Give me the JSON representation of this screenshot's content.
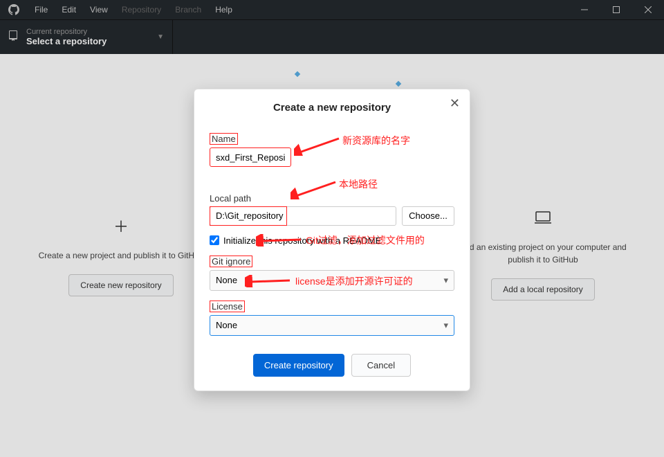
{
  "menu": {
    "file": "File",
    "edit": "Edit",
    "view": "View",
    "repository": "Repository",
    "branch": "Branch",
    "help": "Help"
  },
  "repoSelector": {
    "label": "Current repository",
    "value": "Select a repository"
  },
  "welcome": {
    "left": {
      "desc": "Create a new project and publish it to GitHub",
      "button": "Create new repository"
    },
    "right": {
      "desc": "Add an existing project on your computer and publish it to GitHub",
      "button": "Add a local repository"
    }
  },
  "dialog": {
    "title": "Create a new repository",
    "name": {
      "label": "Name",
      "value": "sxd_First_Repository"
    },
    "path": {
      "label": "Local path",
      "value": "D:\\Git_repository",
      "choose": "Choose..."
    },
    "initReadme": {
      "label": "Initialize this repository with a README",
      "checked": true
    },
    "gitignore": {
      "label": "Git ignore",
      "value": "None"
    },
    "license": {
      "label": "License",
      "value": "None"
    },
    "create": "Create repository",
    "cancel": "Cancel"
  },
  "annotations": {
    "name": "新资源库的名字",
    "path": "本地路径",
    "gitignore": "Git过滤，添加过滤文件用的",
    "license": "license是添加开源许可证的"
  }
}
